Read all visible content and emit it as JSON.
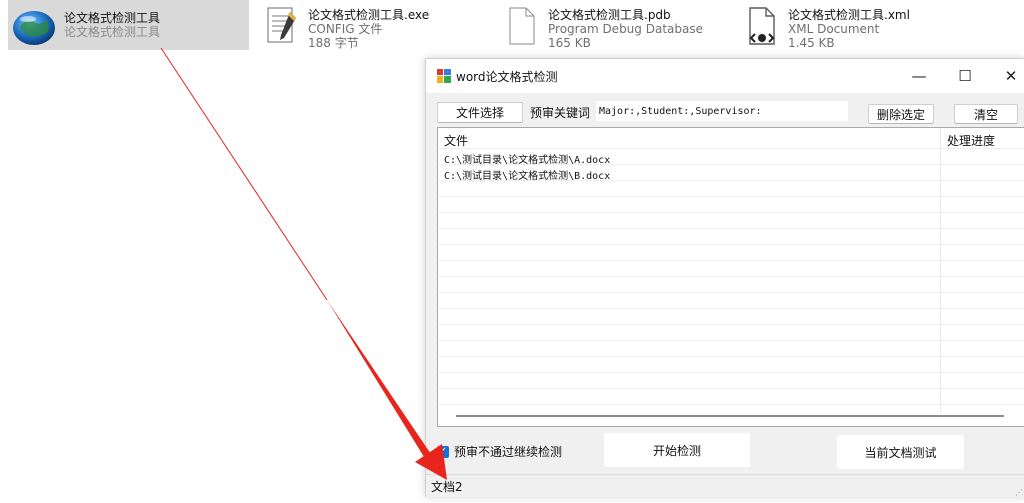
{
  "explorer": {
    "files": [
      {
        "name": "论文格式检测工具",
        "sub1": "论文格式检测工具",
        "sub2": "",
        "icon": "globe-app-icon"
      },
      {
        "name": "论文格式检测工具.exe",
        "sub1": "CONFIG 文件",
        "sub2": "188 字节",
        "icon": "config-file-icon"
      },
      {
        "name": "论文格式检测工具.pdb",
        "sub1": "Program Debug Database",
        "sub2": "165 KB",
        "icon": "blank-document-icon"
      },
      {
        "name": "论文格式检测工具.xml",
        "sub1": "XML Document",
        "sub2": "1.45 KB",
        "icon": "xml-document-icon"
      }
    ]
  },
  "window": {
    "title": "word论文格式检测",
    "controls": {
      "minimize": "—",
      "maximize": "☐",
      "close": "✕"
    },
    "toolbar": {
      "file_select": "文件选择",
      "keyword_label": "预审关键词",
      "keyword_value": "Major:,Student:,Supervisor:",
      "delete_selected": "删除选定",
      "clear": "清空"
    },
    "list": {
      "columns": [
        "文件",
        "处理进度"
      ],
      "rows": [
        {
          "file": "C:\\测试目录\\论文格式检测\\A.docx",
          "progress": ""
        },
        {
          "file": "C:\\测试目录\\论文格式检测\\B.docx",
          "progress": ""
        }
      ]
    },
    "bottom": {
      "checkbox_label": "预审不通过继续检测",
      "checkbox_checked": true,
      "start_button": "开始检测",
      "current_doc_button": "当前文档测试"
    },
    "status": "文档2"
  },
  "colors": {
    "accent": "#1a6fd4",
    "arrow": "#e8251c",
    "selection": "#d9d9d9"
  }
}
